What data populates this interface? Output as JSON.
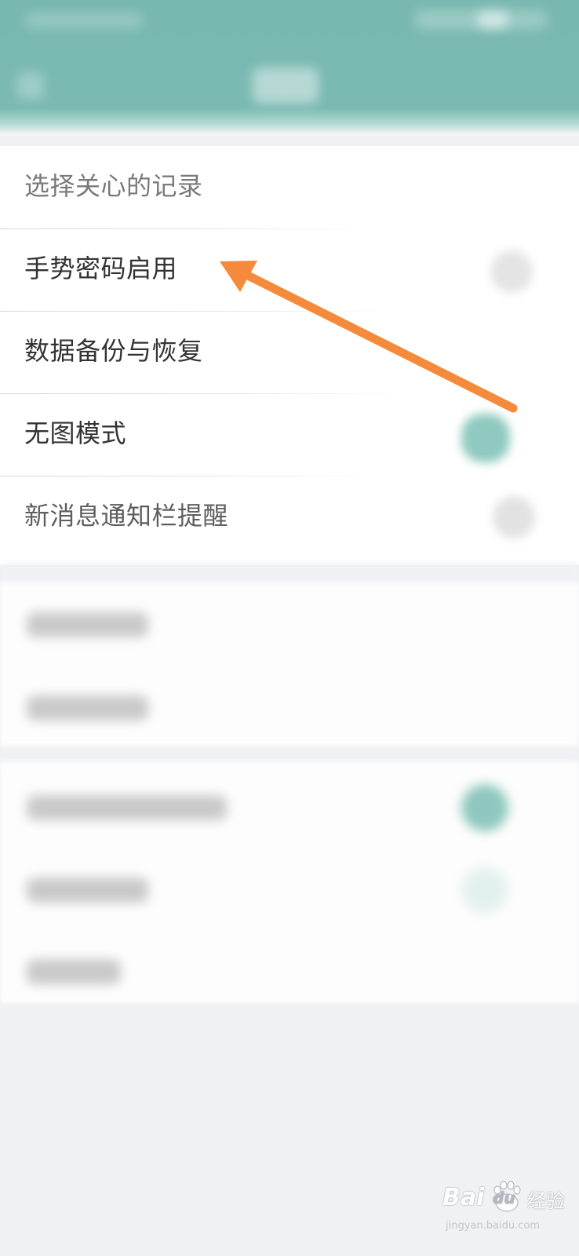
{
  "colors": {
    "header_bg": "#78b8b0",
    "toggle_on": "#7fc2b6",
    "toggle_off": "#d9d9d9",
    "arrow": "#f58a3c",
    "label_text": "#333333",
    "label_text_faded": "#7a7a7a",
    "page_bg": "#eff1f5"
  },
  "settings": {
    "rows": [
      {
        "label": "选择关心的记录",
        "toggle": "none"
      },
      {
        "label": "手势密码启用",
        "toggle": "off"
      },
      {
        "label": "数据备份与恢复",
        "toggle": "none"
      },
      {
        "label": "无图模式",
        "toggle": "on"
      },
      {
        "label": "新消息通知栏提醒",
        "toggle": "off"
      }
    ]
  },
  "annotation": {
    "arrow_target": "手势密码启用"
  },
  "watermark": {
    "brand": "Bai",
    "paw": "du",
    "chinese": "经验",
    "domain": "jingyan.baidu.com"
  }
}
